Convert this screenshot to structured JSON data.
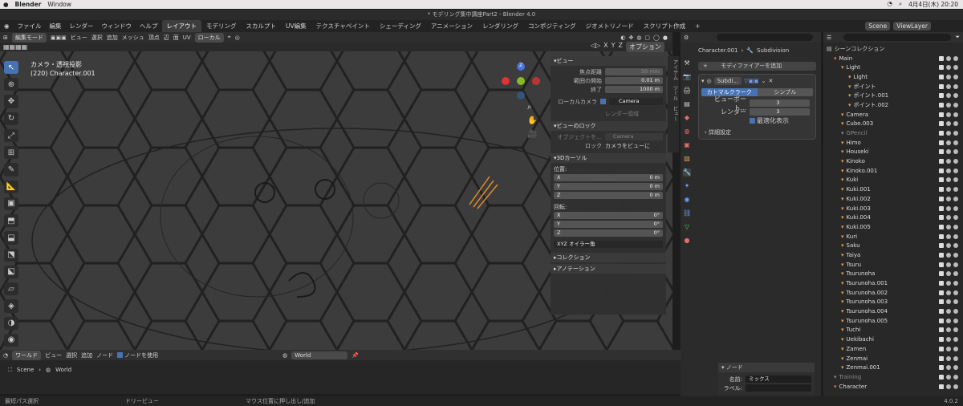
{
  "mac_menu": {
    "app": "Blender",
    "window": "Window",
    "date": "4月4日(木) 20:20"
  },
  "window_title": "* モデリング集中講座Part2 - Blender 4.0",
  "top_menu": [
    "ファイル",
    "編集",
    "レンダー",
    "ウィンドウ",
    "ヘルプ"
  ],
  "workspaces": [
    "レイアウト",
    "モデリング",
    "スカルプト",
    "UV編集",
    "テクスチャペイント",
    "シェーディング",
    "アニメーション",
    "レンダリング",
    "コンポジティング",
    "ジオメトリノード",
    "スクリプト作成"
  ],
  "scene": "Scene",
  "viewlayer": "ViewLayer",
  "viewport_header": {
    "mode": "編集モード",
    "items": [
      "ビュー",
      "選択",
      "追加",
      "メッシュ",
      "頂点",
      "辺",
      "面",
      "UV"
    ],
    "pivot": "ローカル",
    "options": "オプション"
  },
  "viewport_info": {
    "line1": "カメラ・透視投影",
    "line2": "(220) Character.001"
  },
  "npanel": {
    "view_title": "ビュー",
    "focal_label": "焦点距離",
    "focal_value": "50 mm",
    "clip_start_label": "範囲の開始",
    "clip_start_value": "0.01 m",
    "clip_end_label": "終了",
    "clip_end_value": "1000 m",
    "local_camera_label": "ローカルカメラ",
    "local_camera_value": "Camera",
    "render_region": "レンダー領域",
    "lock_title": "ビューのロック",
    "lock_object_label": "オブジェクトを...",
    "lock_object_value": "Camera",
    "lock_label": "ロック",
    "lock_camera": "カメラをビューに",
    "cursor_title": "3Dカーソル",
    "location_label": "位置:",
    "x": "X",
    "y": "Y",
    "z": "Z",
    "loc_x": "0 m",
    "loc_y": "0 m",
    "loc_z": "0 m",
    "rotation_label": "回転:",
    "rot_x": "0°",
    "rot_y": "0°",
    "rot_z": "0°",
    "euler": "XYZ オイラー角",
    "collection": "コレクション",
    "annotation": "アノテーション"
  },
  "sidebar_tabs": [
    "アイテム",
    "ツール",
    "ビュー"
  ],
  "properties": {
    "object": "Character.001",
    "modifier_name": "Subdivision",
    "add_modifier": "モディファイアーを追加",
    "mod_short": "Subdi...",
    "catmull": "カトマルクラーク",
    "simple": "シンプル",
    "viewport_label": "ビューポート...",
    "viewport_value": "3",
    "render_label": "レンダー",
    "render_value": "3",
    "optimal": "最適化表示",
    "advanced": "詳細設定"
  },
  "outliner": {
    "title": "シーンコレクション",
    "items": [
      {
        "name": "Main",
        "indent": 1,
        "color": "#e07070"
      },
      {
        "name": "Light",
        "indent": 2,
        "color": "#e0a050"
      },
      {
        "name": "Light",
        "indent": 3,
        "color": "#e0a050"
      },
      {
        "name": "ポイント",
        "indent": 3,
        "color": "#e0a050"
      },
      {
        "name": "ポイント.001",
        "indent": 3,
        "color": "#e0a050"
      },
      {
        "name": "ポイント.002",
        "indent": 3,
        "color": "#e0a050"
      },
      {
        "name": "Camera",
        "indent": 2,
        "color": "#e0a050"
      },
      {
        "name": "Cube.003",
        "indent": 2,
        "color": "#e0a050"
      },
      {
        "name": "GPencil",
        "indent": 2,
        "color": "#888"
      },
      {
        "name": "Himo",
        "indent": 2,
        "color": "#e0a050"
      },
      {
        "name": "Houseki",
        "indent": 2,
        "color": "#e0a050"
      },
      {
        "name": "Kinoko",
        "indent": 2,
        "color": "#e0a050"
      },
      {
        "name": "Kinoko.001",
        "indent": 2,
        "color": "#e0a050"
      },
      {
        "name": "Kuki",
        "indent": 2,
        "color": "#e0a050"
      },
      {
        "name": "Kuki.001",
        "indent": 2,
        "color": "#e0a050"
      },
      {
        "name": "Kuki.002",
        "indent": 2,
        "color": "#e0a050"
      },
      {
        "name": "Kuki.003",
        "indent": 2,
        "color": "#e0a050"
      },
      {
        "name": "Kuki.004",
        "indent": 2,
        "color": "#e0a050"
      },
      {
        "name": "Kuki.005",
        "indent": 2,
        "color": "#e0a050"
      },
      {
        "name": "Kuri",
        "indent": 2,
        "color": "#e0a050"
      },
      {
        "name": "Saku",
        "indent": 2,
        "color": "#e0a050"
      },
      {
        "name": "Taiya",
        "indent": 2,
        "color": "#e0a050"
      },
      {
        "name": "Tsuru",
        "indent": 2,
        "color": "#e0a050"
      },
      {
        "name": "Tsurunoha",
        "indent": 2,
        "color": "#e0a050"
      },
      {
        "name": "Tsurunoha.001",
        "indent": 2,
        "color": "#e0a050"
      },
      {
        "name": "Tsurunoha.002",
        "indent": 2,
        "color": "#e0a050"
      },
      {
        "name": "Tsurunoha.003",
        "indent": 2,
        "color": "#e0a050"
      },
      {
        "name": "Tsurunoha.004",
        "indent": 2,
        "color": "#e0a050"
      },
      {
        "name": "Tsurunoha.005",
        "indent": 2,
        "color": "#e0a050"
      },
      {
        "name": "Tuchi",
        "indent": 2,
        "color": "#e0a050"
      },
      {
        "name": "Uekibachi",
        "indent": 2,
        "color": "#e0a050"
      },
      {
        "name": "Zamen",
        "indent": 2,
        "color": "#e0a050"
      },
      {
        "name": "Zenmai",
        "indent": 2,
        "color": "#e0a050"
      },
      {
        "name": "Zenmai.001",
        "indent": 2,
        "color": "#e0a050"
      },
      {
        "name": "Training",
        "indent": 1,
        "color": "#888"
      },
      {
        "name": "Character",
        "indent": 1,
        "color": "#e07070"
      }
    ]
  },
  "node_editor": {
    "world_menu": "ワールド",
    "items": [
      "ビュー",
      "選択",
      "追加",
      "ノード"
    ],
    "use_nodes": "ノードを使用",
    "world": "World",
    "breadcrumb_scene": "Scene",
    "breadcrumb_world": "World",
    "panel_title": "ノード",
    "name_label": "名前:",
    "name_value": "ミックス",
    "label_label": "ラベル:"
  },
  "status": {
    "left": "最短パス選択",
    "middle": "ドリービュー",
    "right": "マウス位置に押し出し/追加",
    "version": "4.0.2"
  },
  "colors": {
    "accent": "#4772b3",
    "bg": "#3c3c3c",
    "panel": "#303030"
  }
}
